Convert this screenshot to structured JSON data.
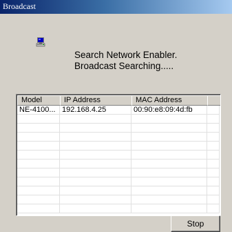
{
  "window": {
    "title": "Broadcast"
  },
  "message": {
    "line1": "Search Network Enabler.",
    "line2": "Broadcast Searching....."
  },
  "table": {
    "columns": [
      "Model",
      "IP Address",
      "MAC Address",
      ""
    ],
    "rows": [
      [
        "NE-4100...",
        "192.168.4.25",
        "00:90:e8:09:4d:fb",
        ""
      ],
      [
        "",
        "",
        "",
        ""
      ],
      [
        "",
        "",
        "",
        ""
      ],
      [
        "",
        "",
        "",
        ""
      ],
      [
        "",
        "",
        "",
        ""
      ],
      [
        "",
        "",
        "",
        ""
      ],
      [
        "",
        "",
        "",
        ""
      ],
      [
        "",
        "",
        "",
        ""
      ],
      [
        "",
        "",
        "",
        ""
      ],
      [
        "",
        "",
        "",
        ""
      ],
      [
        "",
        "",
        "",
        ""
      ],
      [
        "",
        "",
        "",
        ""
      ]
    ]
  },
  "buttons": {
    "stop_label": "Stop"
  },
  "icons": {
    "status": "network-computer-icon"
  }
}
